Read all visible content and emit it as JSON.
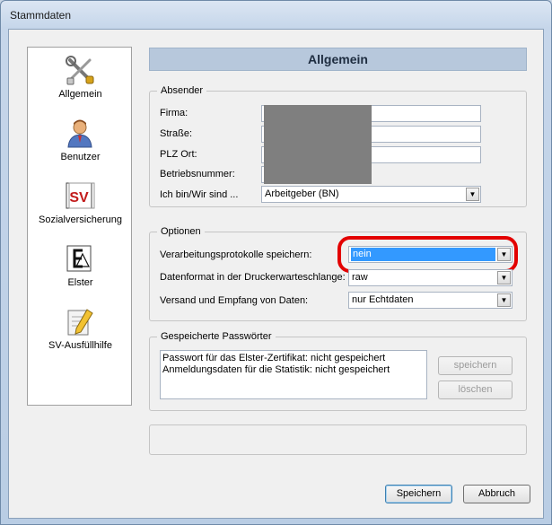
{
  "window": {
    "title": "Stammdaten"
  },
  "sidebar": {
    "items": [
      {
        "label": "Allgemein",
        "icon": "tools-icon"
      },
      {
        "label": "Benutzer",
        "icon": "user-icon"
      },
      {
        "label": "Sozialversicherung",
        "icon": "sv-icon"
      },
      {
        "label": "Elster",
        "icon": "elster-icon"
      },
      {
        "label": "SV-Ausfüllhilfe",
        "icon": "form-pencil-icon"
      }
    ]
  },
  "header": {
    "title": "Allgemein"
  },
  "absender": {
    "legend": "Absender",
    "firma_label": "Firma:",
    "strasse_label": "Straße:",
    "plz_label": "PLZ Ort:",
    "betriebsnummer_label": "Betriebsnummer:",
    "ich_bin_label": "Ich bin/Wir sind ...",
    "ich_bin_value": "Arbeitgeber (BN)"
  },
  "optionen": {
    "legend": "Optionen",
    "protokoll_label": "Verarbeitungsprotokolle speichern:",
    "protokoll_value": "nein",
    "datenformat_label": "Datenformat in der Druckerwarteschlange:",
    "datenformat_value": "raw",
    "versand_label": "Versand und Empfang von Daten:",
    "versand_value": "nur Echtdaten"
  },
  "passwoerter": {
    "legend": "Gespeicherte Passwörter",
    "line1": "Passwort für das Elster-Zertifikat: nicht gespeichert",
    "line2": "Anmeldungsdaten für die Statistik: nicht gespeichert",
    "speichern_label": "speichern",
    "loeschen_label": "löschen"
  },
  "footer": {
    "save_label": "Speichern",
    "cancel_label": "Abbruch"
  },
  "colors": {
    "highlight_ring": "#e30000",
    "selection": "#3399ff",
    "header_bg": "#b7c8dc"
  }
}
